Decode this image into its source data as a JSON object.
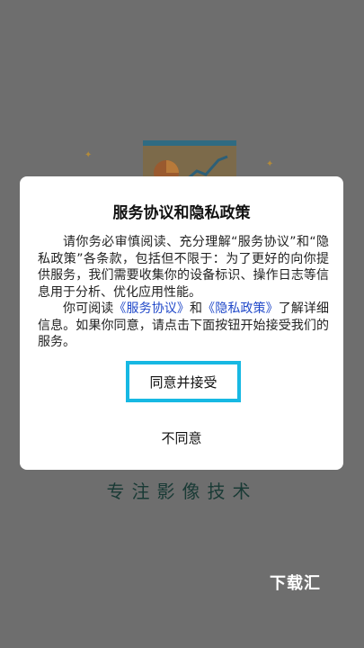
{
  "dialog": {
    "title": "服务协议和隐私政策",
    "paragraph1": "请你务必审慎阅读、充分理解“服务协议”和“隐私政策”各条款，包括但不限于：为了更好的向你提供服务，我们需要收集你的设备标识、操作日志等信息用于分析、优化应用性能。",
    "paragraph2_prefix": "你可阅读",
    "service_link": "《服务协议》",
    "conjunction": "和",
    "privacy_link": "《隐私政策》",
    "paragraph2_suffix": "了解详细信息。如果你同意，请点击下面按钮开始接受我们的服务。",
    "accept_label": "同意并接受",
    "decline_label": "不同意"
  },
  "background": {
    "slogan": "专注影像技术",
    "watermark": "下载汇"
  },
  "colors": {
    "overlay": "#6e6e6e",
    "link": "#2149c9",
    "focus_border": "#17b8e3",
    "slogan": "#193a35"
  }
}
